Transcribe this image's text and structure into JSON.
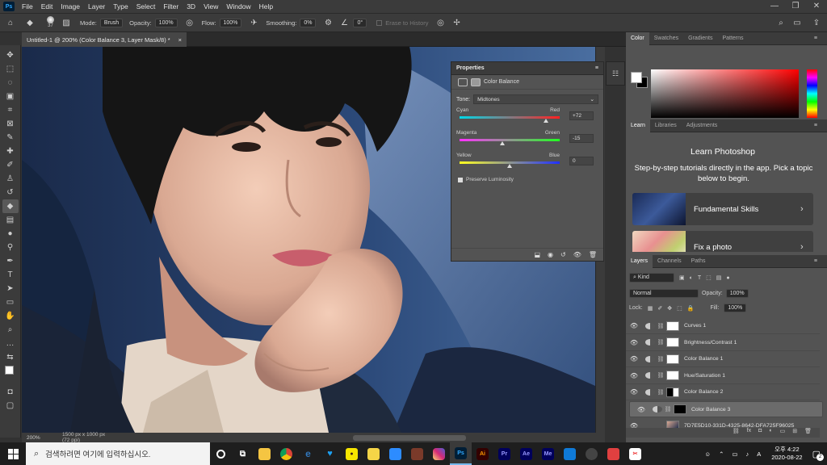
{
  "menu": {
    "logo": "Ps",
    "items": [
      "File",
      "Edit",
      "Image",
      "Layer",
      "Type",
      "Select",
      "Filter",
      "3D",
      "View",
      "Window",
      "Help"
    ],
    "window_controls": [
      "—",
      "❐",
      "✕"
    ]
  },
  "options_bar": {
    "brush_size": "37",
    "mode_label": "Mode:",
    "mode_value": "Brush",
    "opacity_label": "Opacity:",
    "opacity_value": "100%",
    "flow_label": "Flow:",
    "flow_value": "100%",
    "smoothing_label": "Smoothing:",
    "smoothing_value": "0%",
    "angle_value": "0°",
    "erase_to_history": "Erase to History"
  },
  "document": {
    "tab_title": "Untitled-1 @ 200% (Color Balance 3, Layer Mask/8) *",
    "zoom": "200%",
    "dimensions": "1500 px x 1000 px (72 ppi)"
  },
  "properties": {
    "header": "Properties",
    "subtitle": "Color Balance",
    "tone_label": "Tone:",
    "tone_value": "Midtones",
    "sliders": [
      {
        "left": "Cyan",
        "right": "Red",
        "value": "+72",
        "position": 0.86,
        "gradient": "linear-gradient(to right,#00d8e8,#ff2020)"
      },
      {
        "left": "Magenta",
        "right": "Green",
        "value": "-15",
        "position": 0.43,
        "gradient": "linear-gradient(to right,#ff30ff,#20ff20)"
      },
      {
        "left": "Yellow",
        "right": "Blue",
        "value": "0",
        "position": 0.5,
        "gradient": "linear-gradient(to right,#ffff20,#2030ff)"
      }
    ],
    "preserve_luminosity": "Preserve Luminosity"
  },
  "right_panel": {
    "color_tabs": [
      "Color",
      "Swatches",
      "Gradients",
      "Patterns"
    ],
    "learn_tabs": [
      "Learn",
      "Libraries",
      "Adjustments"
    ],
    "learn_title": "Learn Photoshop",
    "learn_desc": "Step-by-step tutorials directly in the app. Pick a topic below to begin.",
    "cards": [
      "Fundamental Skills",
      "Fix a photo"
    ],
    "layer_tabs": [
      "Layers",
      "Channels",
      "Paths"
    ],
    "filter_kind": "Kind",
    "blend_mode": "Normal",
    "opacity_label": "Opacity:",
    "opacity_value": "100%",
    "lock_label": "Lock:",
    "fill_label": "Fill:",
    "fill_value": "100%",
    "layers": [
      {
        "name": "Curves 1",
        "mask": "white"
      },
      {
        "name": "Brightness/Contrast 1",
        "mask": "white"
      },
      {
        "name": "Color Balance 1",
        "mask": "white"
      },
      {
        "name": "Hue/Saturation 1",
        "mask": "white"
      },
      {
        "name": "Color Balance 2",
        "mask": "mixed"
      },
      {
        "name": "Color Balance 3",
        "mask": "black",
        "selected": true
      },
      {
        "name": "7D7E5D10-331D-4325-8642-DFA725F96025",
        "mask": "photo"
      }
    ]
  },
  "taskbar": {
    "search_placeholder": "검색하려면 여기에 입력하십시오.",
    "apps": [
      {
        "name": "Ai",
        "bg": "#330000",
        "fg": "#ff9a00"
      },
      {
        "name": "Pr",
        "bg": "#00005b",
        "fg": "#9999ff"
      },
      {
        "name": "Ae",
        "bg": "#00005b",
        "fg": "#9999ff"
      },
      {
        "name": "Me",
        "bg": "#00005b",
        "fg": "#9999ff"
      }
    ],
    "time": "오후 4:22",
    "date": "2020-08-22",
    "notification_count": "2"
  }
}
